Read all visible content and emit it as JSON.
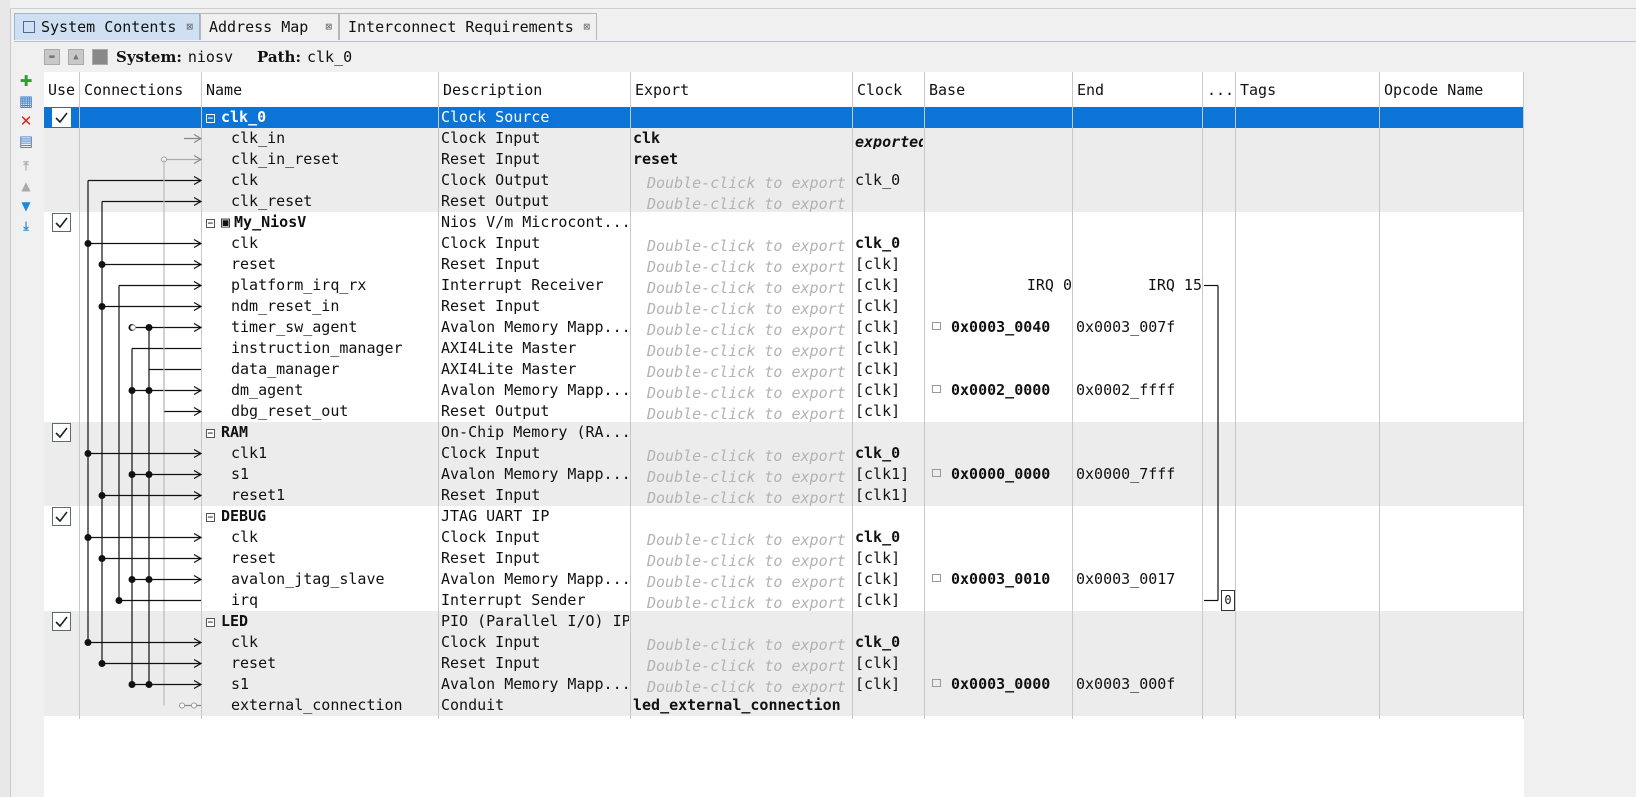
{
  "tabs": [
    {
      "label": "System Contents",
      "active": true
    },
    {
      "label": "Address Map",
      "active": false
    },
    {
      "label": "Interconnect Requirements",
      "active": false
    }
  ],
  "toolbar": {
    "system_label": "System:",
    "system_value": "niosv",
    "path_label": "Path:",
    "path_value": "clk_0"
  },
  "side_buttons": [
    "add-icon",
    "add-component-icon",
    "remove-icon",
    "edit-icon",
    "move-top-icon",
    "move-up-icon",
    "move-down-icon",
    "move-bottom-icon"
  ],
  "columns": [
    "Use",
    "Connections",
    "Name",
    "Description",
    "Export",
    "Clock",
    "Base",
    "End",
    "...",
    "Tags",
    "Opcode Name"
  ],
  "export_placeholder": "Double-click to export",
  "rows": [
    {
      "type": "component",
      "checked": true,
      "name": "clk_0",
      "desc": "Clock Source",
      "export": "",
      "clock": "",
      "base": "",
      "end": "",
      "selected": true
    },
    {
      "type": "iface",
      "name": "clk_in",
      "desc": "Clock Input",
      "export": "clk",
      "clock": "exported",
      "clock_style": "exported",
      "base": "",
      "end": ""
    },
    {
      "type": "iface",
      "name": "clk_in_reset",
      "desc": "Reset Input",
      "export": "reset",
      "clock": "",
      "base": "",
      "end": ""
    },
    {
      "type": "iface",
      "name": "clk",
      "desc": "Clock Output",
      "export": "",
      "clock": "clk_0",
      "base": "",
      "end": ""
    },
    {
      "type": "iface",
      "name": "clk_reset",
      "desc": "Reset Output",
      "export": "",
      "clock": "",
      "base": "",
      "end": ""
    },
    {
      "type": "component",
      "checked": true,
      "name": "My_NiosV",
      "desc": "Nios V/m Microcont...",
      "export": "",
      "clock": "",
      "base": "",
      "end": "",
      "chip": true
    },
    {
      "type": "iface",
      "name": "clk",
      "desc": "Clock Input",
      "export": "",
      "clock": "clk_0",
      "clock_style": "bold",
      "base": "",
      "end": ""
    },
    {
      "type": "iface",
      "name": "reset",
      "desc": "Reset Input",
      "export": "",
      "clock": "[clk]",
      "base": "",
      "end": ""
    },
    {
      "type": "iface",
      "name": "platform_irq_rx",
      "desc": "Interrupt Receiver",
      "export": "",
      "clock": "[clk]",
      "base": "IRQ 0",
      "end": "IRQ 15",
      "irq": true
    },
    {
      "type": "iface",
      "name": "ndm_reset_in",
      "desc": "Reset Input",
      "export": "",
      "clock": "[clk]",
      "base": "",
      "end": ""
    },
    {
      "type": "iface",
      "name": "timer_sw_agent",
      "desc": "Avalon Memory Mapp...",
      "export": "",
      "clock": "[clk]",
      "base": "0x0003_0040",
      "end": "0x0003_007f"
    },
    {
      "type": "iface",
      "name": "instruction_manager",
      "desc": "AXI4Lite Master",
      "export": "",
      "clock": "[clk]",
      "base": "",
      "end": ""
    },
    {
      "type": "iface",
      "name": "data_manager",
      "desc": "AXI4Lite Master",
      "export": "",
      "clock": "[clk]",
      "base": "",
      "end": ""
    },
    {
      "type": "iface",
      "name": "dm_agent",
      "desc": "Avalon Memory Mapp...",
      "export": "",
      "clock": "[clk]",
      "base": "0x0002_0000",
      "end": "0x0002_ffff"
    },
    {
      "type": "iface",
      "name": "dbg_reset_out",
      "desc": "Reset Output",
      "export": "",
      "clock": "[clk]",
      "base": "",
      "end": ""
    },
    {
      "type": "component",
      "checked": true,
      "name": "RAM",
      "desc": "On-Chip Memory (RA...",
      "export": "",
      "clock": "",
      "base": "",
      "end": ""
    },
    {
      "type": "iface",
      "name": "clk1",
      "desc": "Clock Input",
      "export": "",
      "clock": "clk_0",
      "clock_style": "bold",
      "base": "",
      "end": ""
    },
    {
      "type": "iface",
      "name": "s1",
      "desc": "Avalon Memory Mapp...",
      "export": "",
      "clock": "[clk1]",
      "base": "0x0000_0000",
      "end": "0x0000_7fff"
    },
    {
      "type": "iface",
      "name": "reset1",
      "desc": "Reset Input",
      "export": "",
      "clock": "[clk1]",
      "base": "",
      "end": ""
    },
    {
      "type": "component",
      "checked": true,
      "name": "DEBUG",
      "desc": "JTAG UART IP",
      "export": "",
      "clock": "",
      "base": "",
      "end": ""
    },
    {
      "type": "iface",
      "name": "clk",
      "desc": "Clock Input",
      "export": "",
      "clock": "clk_0",
      "clock_style": "bold",
      "base": "",
      "end": ""
    },
    {
      "type": "iface",
      "name": "reset",
      "desc": "Reset Input",
      "export": "",
      "clock": "[clk]",
      "base": "",
      "end": ""
    },
    {
      "type": "iface",
      "name": "avalon_jtag_slave",
      "desc": "Avalon Memory Mapp...",
      "export": "",
      "clock": "[clk]",
      "base": "0x0003_0010",
      "end": "0x0003_0017"
    },
    {
      "type": "iface",
      "name": "irq",
      "desc": "Interrupt Sender",
      "export": "",
      "clock": "[clk]",
      "base": "",
      "end": "",
      "irq_num": "0"
    },
    {
      "type": "component",
      "checked": true,
      "name": "LED",
      "desc": "PIO (Parallel I/O) IP",
      "export": "",
      "clock": "",
      "base": "",
      "end": ""
    },
    {
      "type": "iface",
      "name": "clk",
      "desc": "Clock Input",
      "export": "",
      "clock": "clk_0",
      "clock_style": "bold",
      "base": "",
      "end": ""
    },
    {
      "type": "iface",
      "name": "reset",
      "desc": "Reset Input",
      "export": "",
      "clock": "[clk]",
      "base": "",
      "end": ""
    },
    {
      "type": "iface",
      "name": "s1",
      "desc": "Avalon Memory Mapp...",
      "export": "",
      "clock": "[clk]",
      "base": "0x0003_0000",
      "end": "0x0003_000f"
    },
    {
      "type": "iface",
      "name": "external_connection",
      "desc": "Conduit",
      "export": "led_external_connection",
      "clock": "",
      "base": "",
      "end": "",
      "no_placeholder": true
    }
  ],
  "colors": {
    "selected_row": "#0c74d6",
    "group_shade": "#ececec",
    "accent_add": "#2ca02c",
    "accent_remove": "#e02020",
    "accent_move": "#1e88d6"
  }
}
